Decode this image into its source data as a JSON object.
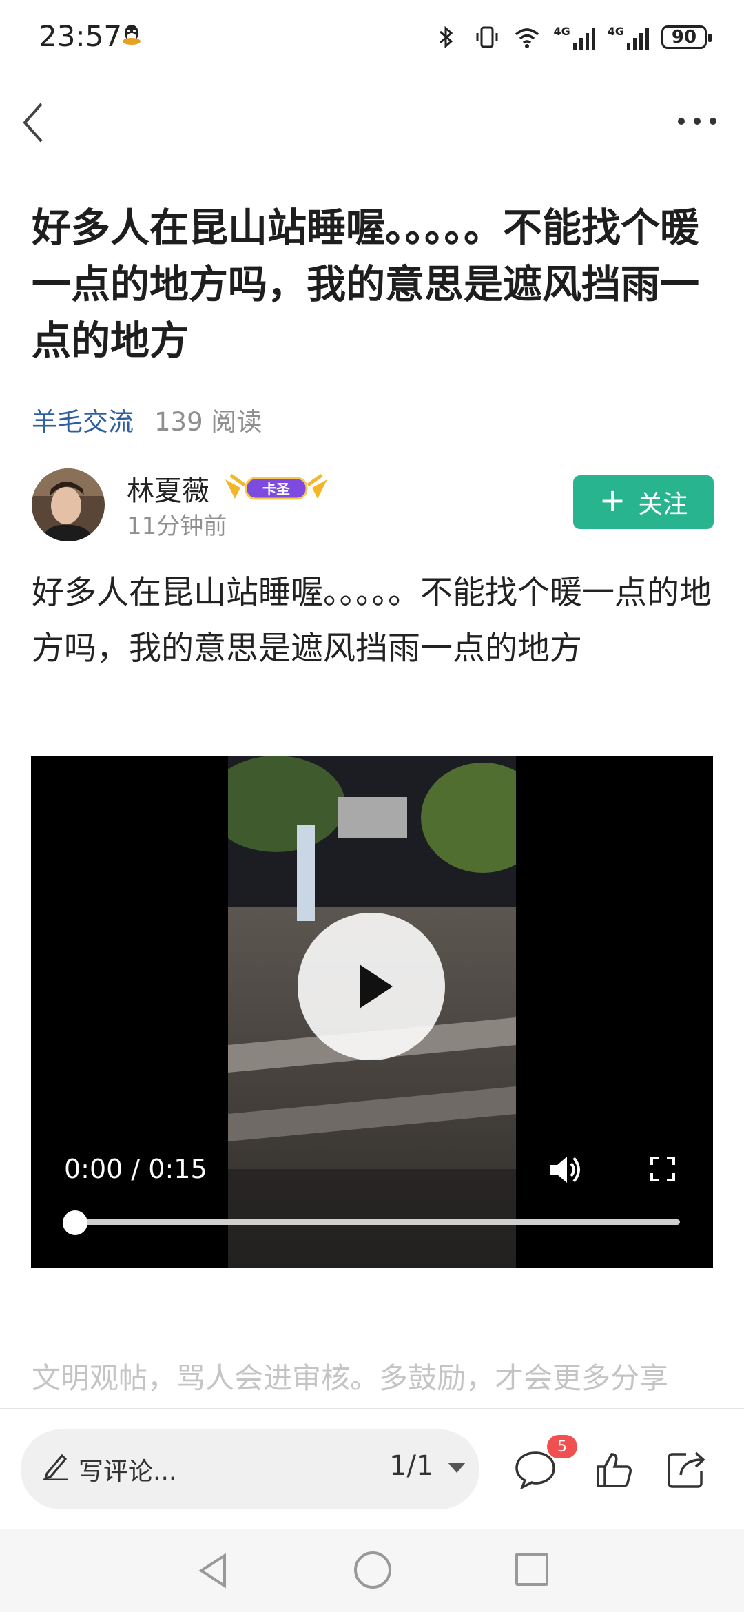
{
  "status_bar": {
    "time": "23:57",
    "network_1": "4G",
    "network_2": "4G",
    "battery": "90",
    "icons": [
      "qq-icon",
      "bluetooth-icon",
      "vibrate-icon",
      "wifi-icon",
      "signal-icon",
      "battery-icon"
    ]
  },
  "nav": {
    "back_icon": "chevron-left-icon",
    "more_icon": "more-dots-icon"
  },
  "post": {
    "title": "好多人在昆山站睡喔。。。。。不能找个暖一点的地方吗，我的意思是遮风挡雨一点的地方",
    "category": "羊毛交流",
    "views": "139 阅读",
    "author": {
      "name": "林夏薇",
      "badge": "卡圣",
      "time": "11分钟前"
    },
    "follow_label": "关注",
    "body": "好多人在昆山站睡喔。。。。。不能找个暖一点的地方吗，我的意思是遮风挡雨一点的地方"
  },
  "video": {
    "time": "0:00 / 0:15",
    "progress": 0.0
  },
  "notice": "文明观帖，骂人会进审核。多鼓励，才会更多分享",
  "bottom_bar": {
    "comment_placeholder": "写评论...",
    "page_indicator": "1/1",
    "comment_count": "5"
  },
  "colors": {
    "accent": "#27b48f",
    "category": "#2f5f9e",
    "badge": "#f05050"
  }
}
